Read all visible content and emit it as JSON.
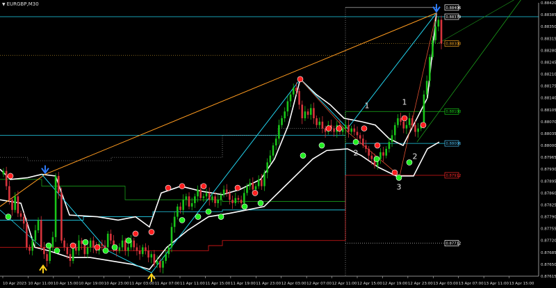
{
  "symbol": "EURGBP,M30",
  "chart_data": {
    "type": "candlestick",
    "ylim": [
      0.87615,
      0.8842
    ],
    "y_ticks": [
      "0.88420",
      "0.88385",
      "0.88350",
      "0.88315",
      "0.88280",
      "0.88245",
      "0.88210",
      "0.88175",
      "0.88140",
      "0.88105",
      "0.88070",
      "0.88035",
      "0.88000",
      "0.87965",
      "0.87930",
      "0.87895",
      "0.87860",
      "0.87825",
      "0.87790",
      "0.87755",
      "0.87720",
      "0.87685",
      "0.87650",
      "0.87615"
    ],
    "x_ticks": [
      "10 Apr 2023",
      "10 Apr 11:00",
      "10 Apr 15:00",
      "10 Apr 19:00",
      "10 Apr 23:00",
      "11 Apr 03:00",
      "11 Apr 07:00",
      "11 Apr 11:00",
      "11 Apr 15:00",
      "11 Apr 19:00",
      "11 Apr 23:00",
      "12 Apr 03:00",
      "12 Apr 07:00",
      "12 Apr 11:00",
      "12 Apr 15:00",
      "12 Apr 19:00",
      "12 Apr 23:00",
      "13 Apr 03:00",
      "13 Apr 07:00",
      "13 Apr 11:00",
      "13 Apr 15:00"
    ],
    "price_boxes": [
      {
        "label": "0.88406",
        "color": "#ffffff"
      },
      {
        "label": "0.88379",
        "color": "#ffffff"
      },
      {
        "label": "0.88300",
        "color": "#f5a623"
      },
      {
        "label": "0.88100",
        "color": "#19d219"
      },
      {
        "label": "0.88006",
        "color": "#4fc3f7"
      },
      {
        "label": "0.87912",
        "color": "#ff2a2a"
      },
      {
        "label": "0.87712",
        "color": "#ffffff"
      }
    ],
    "wave_labels": [
      "1",
      "2",
      "3",
      "1",
      "2"
    ],
    "colors": {
      "bull": "#19c419",
      "bear": "#d8343c",
      "band": "#ffffff",
      "cyan": "#22d3ee",
      "orange": "#ff9b1f",
      "green": "#1eb41e",
      "red": "#e01818"
    },
    "closes": [
      0.87925,
      0.8788,
      0.8784,
      0.8781,
      0.8785,
      0.878,
      0.8779,
      0.8777,
      0.877,
      0.8769,
      0.8772,
      0.8775,
      0.8778,
      0.877,
      0.8768,
      0.8766,
      0.877,
      0.8773,
      0.8791,
      0.8786,
      0.8772,
      0.877,
      0.8768,
      0.8766,
      0.877,
      0.8769,
      0.8772,
      0.8771,
      0.8768,
      0.877,
      0.8772,
      0.877,
      0.8769,
      0.8771,
      0.87705,
      0.877,
      0.8774,
      0.8772,
      0.877,
      0.8769,
      0.877,
      0.8772,
      0.8769,
      0.877,
      0.8772,
      0.877,
      0.8769,
      0.8768,
      0.877,
      0.8769,
      0.8767,
      0.8768,
      0.8765,
      0.8766,
      0.8764,
      0.8766,
      0.8768,
      0.877,
      0.8776,
      0.8779,
      0.8782,
      0.8781,
      0.8784,
      0.8785,
      0.8782,
      0.8783,
      0.8785,
      0.8787,
      0.87845,
      0.8785,
      0.8786,
      0.8784,
      0.8785,
      0.8783,
      0.8784,
      0.87855,
      0.8787,
      0.8786,
      0.8784,
      0.8783,
      0.87845,
      0.8784,
      0.8783,
      0.8786,
      0.8788,
      0.8789,
      0.8787,
      0.8788,
      0.879,
      0.8788,
      0.8792,
      0.8795,
      0.8797,
      0.88,
      0.8802,
      0.8806,
      0.8808,
      0.881,
      0.8813,
      0.8815,
      0.8817,
      0.8816,
      0.8812,
      0.8808,
      0.881,
      0.8809,
      0.8811,
      0.8808,
      0.8806,
      0.8807,
      0.8805,
      0.8804,
      0.8806,
      0.8805,
      0.8804,
      0.8806,
      0.8804,
      0.8805,
      0.8806,
      0.8804,
      0.8805,
      0.8804,
      0.8803,
      0.8802,
      0.88,
      0.8799,
      0.8797,
      0.8796,
      0.8794,
      0.8796,
      0.8798,
      0.8797,
      0.8799,
      0.8801,
      0.8803,
      0.8806,
      0.8808,
      0.8807,
      0.8805,
      0.8806,
      0.8808,
      0.8806,
      0.8804,
      0.8805,
      0.8806,
      0.8815,
      0.8819,
      0.8826,
      0.8831,
      0.8835,
      0.8837,
      0.883
    ]
  }
}
